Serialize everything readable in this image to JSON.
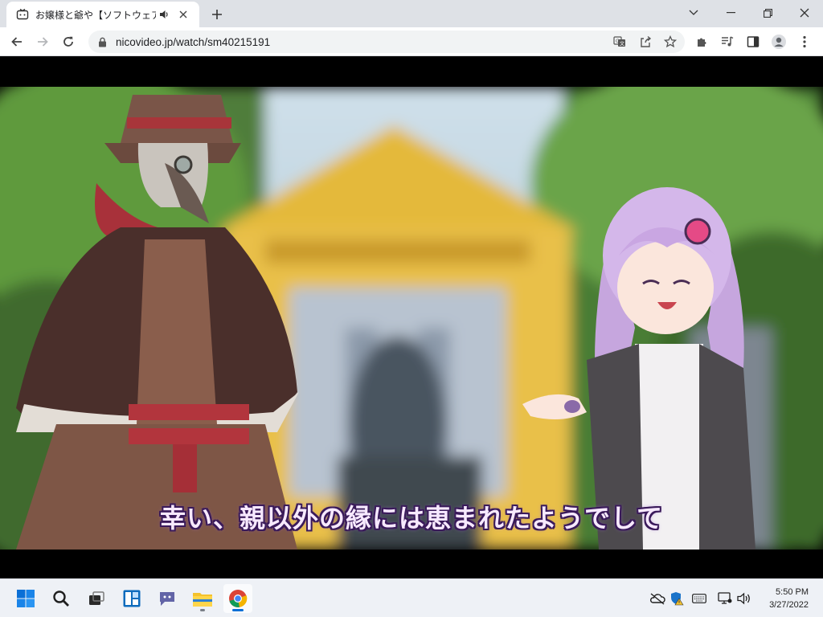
{
  "browser": {
    "tab": {
      "title": "お嬢様と爺や【ソフトウェアトーク劇場】",
      "favicon": "nicovideo-tv-icon",
      "audio": "speaker-icon"
    },
    "url": "nicovideo.jp/watch/sm40215191"
  },
  "video": {
    "subtitle": "幸い、親以外の縁には恵まれたようでして"
  },
  "taskbar": {
    "time": "5:50 PM",
    "date": "3/27/2022"
  },
  "colors": {
    "titlebar": "#dee1e6",
    "toolbar": "#ffffff",
    "omnibox": "#f1f3f4",
    "taskbar": "#eef1f6",
    "subtitle_fill": "#f7e9ff",
    "subtitle_outline": "#3a1a5a"
  }
}
